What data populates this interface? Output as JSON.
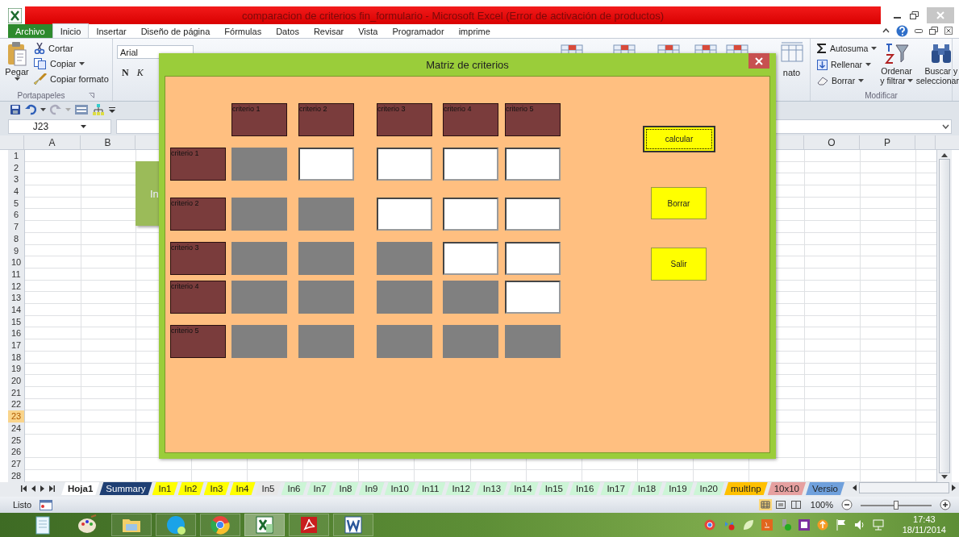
{
  "window": {
    "title": "comparacion de criterios fin_formulario  -  Microsoft Excel (Error de activación de productos)"
  },
  "ribbon_tabs": [
    {
      "label": "Archivo",
      "kind": "file",
      "selected": false
    },
    {
      "label": "Inicio",
      "kind": "tab",
      "selected": true
    },
    {
      "label": "Insertar",
      "kind": "tab",
      "selected": false
    },
    {
      "label": "Diseño de página",
      "kind": "tab",
      "selected": false
    },
    {
      "label": "Fórmulas",
      "kind": "tab",
      "selected": false
    },
    {
      "label": "Datos",
      "kind": "tab",
      "selected": false
    },
    {
      "label": "Revisar",
      "kind": "tab",
      "selected": false
    },
    {
      "label": "Vista",
      "kind": "tab",
      "selected": false
    },
    {
      "label": "Programador",
      "kind": "tab",
      "selected": false
    },
    {
      "label": "imprime",
      "kind": "tab",
      "selected": false
    }
  ],
  "clipboard": {
    "paste": "Pegar",
    "cut": "Cortar",
    "copy": "Copiar",
    "format_painter": "Copiar formato",
    "group": "Portapapeles"
  },
  "font": {
    "name": "Arial",
    "bold": "N",
    "italic": "K"
  },
  "format_fragment": "nato",
  "editing": {
    "autosum": "Autosuma",
    "fill": "Rellenar",
    "clear": "Borrar",
    "sort": "Ordenar",
    "sort_2": "y filtrar",
    "find": "Buscar y",
    "find_2": "seleccionar",
    "group": "Modificar"
  },
  "name_box": "J23",
  "columns": [
    "A",
    "B",
    "O",
    "P"
  ],
  "rows": [
    {
      "label": "1",
      "selected": false
    },
    {
      "label": "2",
      "selected": false
    },
    {
      "label": "3",
      "selected": false
    },
    {
      "label": "4",
      "selected": false
    },
    {
      "label": "5",
      "selected": false
    },
    {
      "label": "6",
      "selected": false
    },
    {
      "label": "7",
      "selected": false
    },
    {
      "label": "8",
      "selected": false
    },
    {
      "label": "9",
      "selected": false
    },
    {
      "label": "10",
      "selected": false
    },
    {
      "label": "11",
      "selected": false
    },
    {
      "label": "12",
      "selected": false
    },
    {
      "label": "13",
      "selected": false
    },
    {
      "label": "14",
      "selected": false
    },
    {
      "label": "15",
      "selected": false
    },
    {
      "label": "16",
      "selected": false
    },
    {
      "label": "17",
      "selected": false
    },
    {
      "label": "18",
      "selected": false
    },
    {
      "label": "19",
      "selected": false
    },
    {
      "label": "20",
      "selected": false
    },
    {
      "label": "21",
      "selected": false
    },
    {
      "label": "22",
      "selected": false
    },
    {
      "label": "23",
      "selected": true
    },
    {
      "label": "24",
      "selected": false
    },
    {
      "label": "25",
      "selected": false
    },
    {
      "label": "26",
      "selected": false
    },
    {
      "label": "27",
      "selected": false
    },
    {
      "label": "28",
      "selected": false
    }
  ],
  "sheet_shape": {
    "text": "In"
  },
  "sheet_tabs": [
    {
      "label": "Hoja1",
      "selected": true,
      "color": "#ffffff"
    },
    {
      "label": "Summary",
      "selected": false,
      "color": "#1f3f73"
    },
    {
      "label": "In1",
      "selected": false,
      "color": "#ffff00"
    },
    {
      "label": "In2",
      "selected": false,
      "color": "#ffff00"
    },
    {
      "label": "In3",
      "selected": false,
      "color": "#ffff00"
    },
    {
      "label": "In4",
      "selected": false,
      "color": "#ffff00"
    },
    {
      "label": "In5",
      "selected": false,
      "color": "#e8e8e8"
    },
    {
      "label": "In6",
      "selected": false,
      "color": "#ccf5d6"
    },
    {
      "label": "In7",
      "selected": false,
      "color": "#ccf5d6"
    },
    {
      "label": "In8",
      "selected": false,
      "color": "#ccf5d6"
    },
    {
      "label": "In9",
      "selected": false,
      "color": "#ccf5d6"
    },
    {
      "label": "In10",
      "selected": false,
      "color": "#ccf5d6"
    },
    {
      "label": "In11",
      "selected": false,
      "color": "#ccf5d6"
    },
    {
      "label": "In12",
      "selected": false,
      "color": "#ccf5d6"
    },
    {
      "label": "In13",
      "selected": false,
      "color": "#ccf5d6"
    },
    {
      "label": "In14",
      "selected": false,
      "color": "#ccf5d6"
    },
    {
      "label": "In15",
      "selected": false,
      "color": "#ccf5d6"
    },
    {
      "label": "In16",
      "selected": false,
      "color": "#ccf5d6"
    },
    {
      "label": "In17",
      "selected": false,
      "color": "#ccf5d6"
    },
    {
      "label": "In18",
      "selected": false,
      "color": "#ccf5d6"
    },
    {
      "label": "In19",
      "selected": false,
      "color": "#ccf5d6"
    },
    {
      "label": "In20",
      "selected": false,
      "color": "#ccf5d6"
    },
    {
      "label": "multInp",
      "selected": false,
      "color": "#ffc000"
    },
    {
      "label": "10x10",
      "selected": false,
      "color": "#e6a0a0"
    },
    {
      "label": "Versio",
      "selected": false,
      "color": "#6fa0dc"
    }
  ],
  "status": {
    "text": "Listo",
    "zoom": "100%",
    "level": 0.5
  },
  "taskbar": {
    "time": "17:43",
    "date": "18/11/2014"
  },
  "dialog": {
    "title": "Matriz de criterios",
    "columns": [
      "criterio 1",
      "criterio 2",
      "criterio 3",
      "criterio 4",
      "criterio 5"
    ],
    "rows": [
      {
        "label": "criterio 1",
        "cells": [
          {
            "disabled": true
          },
          {
            "disabled": false
          },
          {
            "disabled": false
          },
          {
            "disabled": false
          },
          {
            "disabled": false
          }
        ]
      },
      {
        "label": "criterio 2",
        "cells": [
          {
            "disabled": true
          },
          {
            "disabled": true
          },
          {
            "disabled": false
          },
          {
            "disabled": false
          },
          {
            "disabled": false
          }
        ]
      },
      {
        "label": "criterio 3",
        "cells": [
          {
            "disabled": true
          },
          {
            "disabled": true
          },
          {
            "disabled": true
          },
          {
            "disabled": false
          },
          {
            "disabled": false
          }
        ]
      },
      {
        "label": "criterio 4",
        "cells": [
          {
            "disabled": true
          },
          {
            "disabled": true
          },
          {
            "disabled": true
          },
          {
            "disabled": true
          },
          {
            "disabled": false
          }
        ]
      },
      {
        "label": "criterio 5",
        "cells": [
          {
            "disabled": true
          },
          {
            "disabled": true
          },
          {
            "disabled": true
          },
          {
            "disabled": true
          },
          {
            "disabled": true
          }
        ]
      }
    ],
    "buttons": [
      {
        "label": "calcular",
        "focused": true
      },
      {
        "label": "Borrar",
        "focused": false
      },
      {
        "label": "Salir",
        "focused": false
      }
    ]
  }
}
